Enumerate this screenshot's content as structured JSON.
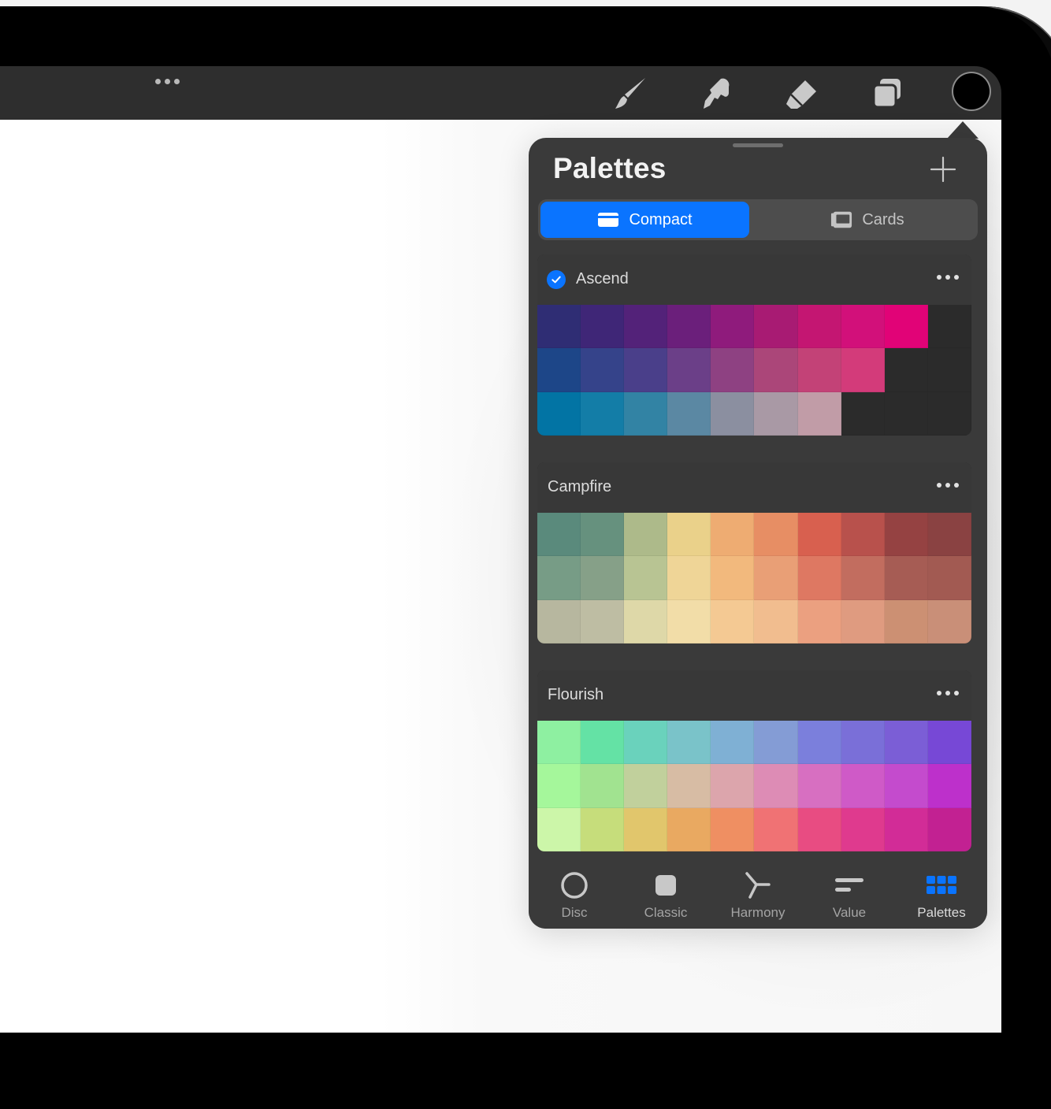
{
  "colors": {
    "accent": "#0a74ff",
    "panel": "#3a3a3a",
    "toolbar": "#2e2e2e",
    "current_color": "#000000"
  },
  "toolbar": {
    "more_icon": "ellipsis-icon",
    "tools": [
      "brush-icon",
      "smudge-icon",
      "eraser-icon",
      "layers-icon"
    ],
    "color_well": "color-well"
  },
  "panel": {
    "title": "Palettes",
    "add_icon": "plus-icon",
    "view_toggle": {
      "options": [
        {
          "label": "Compact",
          "icon": "compact-card-icon",
          "active": true
        },
        {
          "label": "Cards",
          "icon": "cards-icon",
          "active": false
        }
      ]
    },
    "palettes": [
      {
        "name": "Ascend",
        "default": true,
        "more_icon": "ellipsis-icon",
        "rows": [
          [
            "#2f2d74",
            "#3f2677",
            "#532279",
            "#6b1f7b",
            "#8f1b7c",
            "#a81b73",
            "#c41672",
            "#d2107a",
            "#e10377",
            "#2b2b2b"
          ],
          [
            "#1d4688",
            "#35438a",
            "#4a3f8a",
            "#6b3f88",
            "#8e4182",
            "#ab4679",
            "#c34277",
            "#d33b7a",
            "#2b2b2b",
            "#2b2b2b"
          ],
          [
            "#0274a4",
            "#137da7",
            "#3283a4",
            "#5b88a3",
            "#8b8fa0",
            "#a999a5",
            "#c19ca7",
            "#2b2b2b",
            "#2b2b2b",
            "#2b2b2b"
          ]
        ]
      },
      {
        "name": "Campfire",
        "default": false,
        "more_icon": "ellipsis-icon",
        "rows": [
          [
            "#5a8a7c",
            "#66917e",
            "#adba8a",
            "#ead18a",
            "#eeac72",
            "#e78e64",
            "#d8604f",
            "#b8514c",
            "#954242",
            "#8a4242"
          ],
          [
            "#779c86",
            "#86a088",
            "#b8c493",
            "#efd597",
            "#f2b97d",
            "#e99f76",
            "#de7862",
            "#c26d5f",
            "#a65c54",
            "#a25a52"
          ],
          [
            "#b7b79f",
            "#bebda3",
            "#ded8a8",
            "#f2dda8",
            "#f4c993",
            "#f1bd8f",
            "#eba080",
            "#df9b80",
            "#cc9073",
            "#c98f78"
          ]
        ]
      },
      {
        "name": "Flourish",
        "default": false,
        "more_icon": "ellipsis-icon",
        "rows": [
          [
            "#8ef0a1",
            "#64e2a5",
            "#6ad2bc",
            "#7ac3c9",
            "#7fb0d4",
            "#849cd5",
            "#7b7fdc",
            "#7a6fd8",
            "#7b5ed6",
            "#7748d6"
          ],
          [
            "#a5f79b",
            "#a1e390",
            "#c1d09c",
            "#d7bca4",
            "#dca5ac",
            "#dd8cb5",
            "#d76fc1",
            "#cf5ac7",
            "#c44bcd",
            "#bd30cb"
          ],
          [
            "#ccf6a9",
            "#c6dd7b",
            "#e1c66c",
            "#e9a961",
            "#ef8f62",
            "#f07274",
            "#e84c82",
            "#df3a8e",
            "#d22c97",
            "#c22192"
          ]
        ]
      }
    ],
    "tabs": [
      {
        "label": "Disc",
        "icon": "disc-icon",
        "active": false
      },
      {
        "label": "Classic",
        "icon": "classic-square-icon",
        "active": false
      },
      {
        "label": "Harmony",
        "icon": "harmony-icon",
        "active": false
      },
      {
        "label": "Value",
        "icon": "value-sliders-icon",
        "active": false
      },
      {
        "label": "Palettes",
        "icon": "palettes-grid-icon",
        "active": true
      }
    ]
  }
}
